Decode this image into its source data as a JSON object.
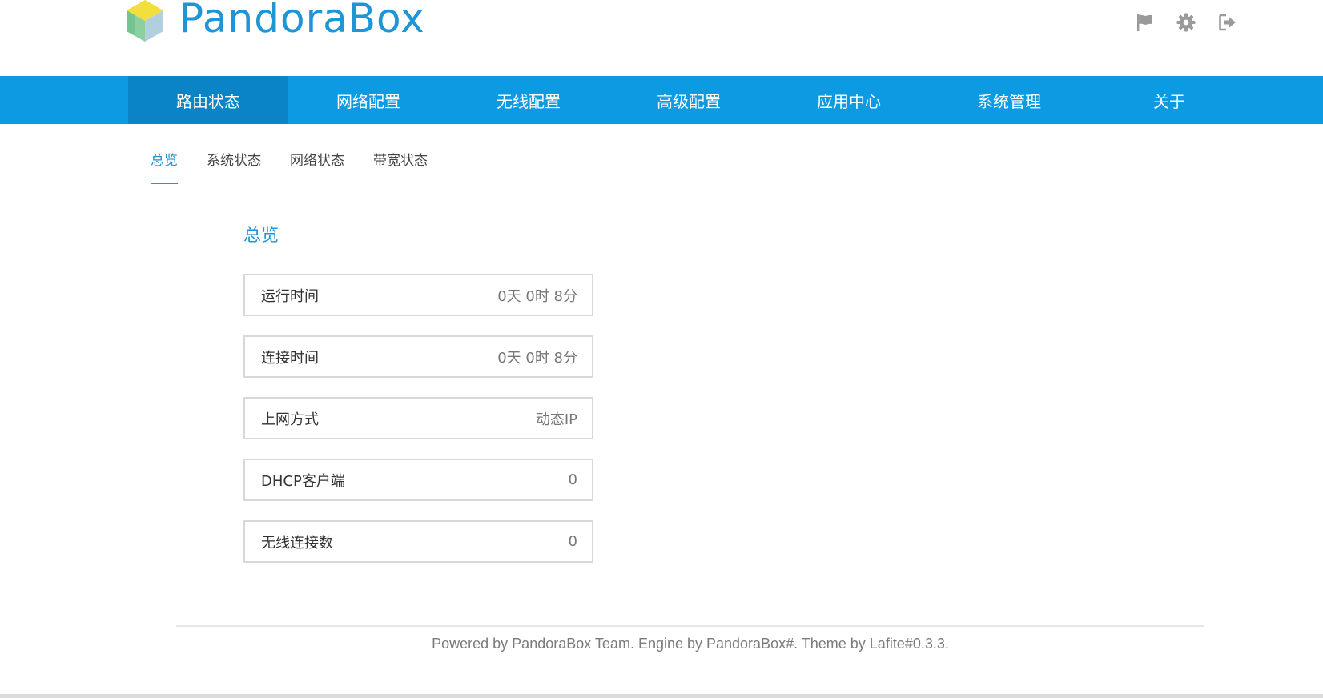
{
  "header": {
    "logo_text": "PandoraBox",
    "icons": [
      "flag-icon",
      "gear-icon",
      "logout-icon"
    ]
  },
  "main_nav": {
    "items": [
      {
        "label": "路由状态",
        "active": true
      },
      {
        "label": "网络配置",
        "active": false
      },
      {
        "label": "无线配置",
        "active": false
      },
      {
        "label": "高级配置",
        "active": false
      },
      {
        "label": "应用中心",
        "active": false
      },
      {
        "label": "系统管理",
        "active": false
      },
      {
        "label": "关于",
        "active": false
      }
    ]
  },
  "sub_tabs": {
    "items": [
      {
        "label": "总览",
        "active": true
      },
      {
        "label": "系统状态",
        "active": false
      },
      {
        "label": "网络状态",
        "active": false
      },
      {
        "label": "带宽状态",
        "active": false
      }
    ]
  },
  "overview": {
    "title": "总览",
    "cards": [
      {
        "label": "运行时间",
        "value": "0天 0时 8分"
      },
      {
        "label": "连接时间",
        "value": "0天 0时 8分"
      },
      {
        "label": "上网方式",
        "value": "动态IP"
      },
      {
        "label": "DHCP客户端",
        "value": "0"
      },
      {
        "label": "无线连接数",
        "value": "0"
      }
    ]
  },
  "footer": {
    "text": "Powered by PandoraBox Team. Engine by PandoraBox#. Theme by Lafite#0.3.3."
  },
  "colors": {
    "accent": "#1d95d6",
    "nav_bg": "#0c9ae3",
    "nav_active_bg": "#0a84c6",
    "card_border": "#d8d8d8"
  }
}
